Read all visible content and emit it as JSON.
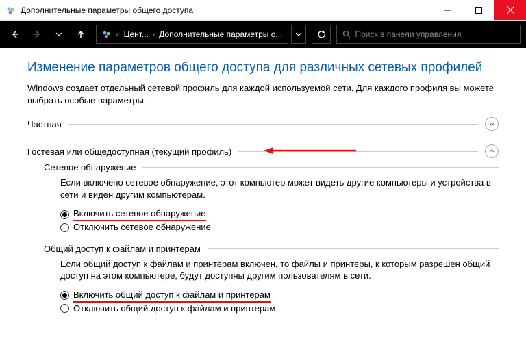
{
  "window": {
    "title": "Дополнительные параметры общего доступа"
  },
  "toolbar": {
    "crumb1": "Цент...",
    "crumb2": "Дополнительные параметры о...",
    "search_placeholder": "Поиск в панели управления"
  },
  "page": {
    "title": "Изменение параметров общего доступа для различных сетевых профилей",
    "desc": "Windows создает отдельный сетевой профиль для каждой используемой сети. Для каждого профиля вы можете выбрать особые параметры."
  },
  "private": {
    "label": "Частная"
  },
  "guest": {
    "label": "Гостевая или общедоступная (текущий профиль)",
    "discovery": {
      "title": "Сетевое обнаружение",
      "desc": "Если включено сетевое обнаружение, этот компьютер может видеть другие компьютеры и устройства в сети и виден другим компьютерам.",
      "on": "Включить сетевое обнаружение",
      "off": "Отключить сетевое обнаружение"
    },
    "sharing": {
      "title": "Общий доступ к файлам и принтерам",
      "desc": "Если общий доступ к файлам и принтерам включен, то файлы и принтеры, к которым разрешен общий доступ на этом компьютере, будут доступны другим пользователям в сети.",
      "on": "Включить общий доступ к файлам и принтерам",
      "off": "Отключить общий доступ к файлам и принтерам"
    }
  }
}
